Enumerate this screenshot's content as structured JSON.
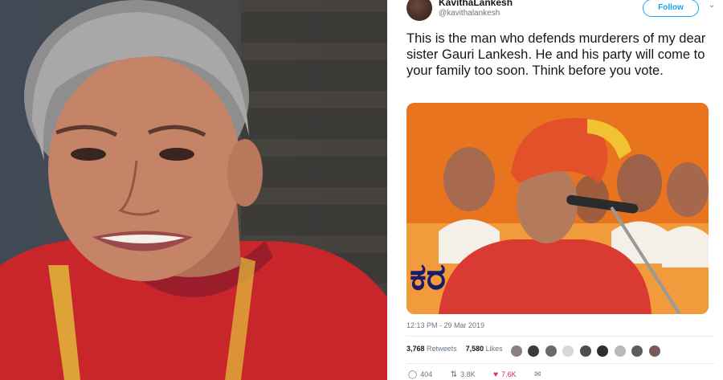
{
  "tweet": {
    "display_name": "KavithaLankesh",
    "handle": "@kavithalankesh",
    "follow_label": "Follow",
    "text": "This is the man who defends murderers of my dear sister  Gauri Lankesh. He and his party will come to your family too soon. Think before you vote.",
    "timestamp": "12:13 PM - 29 Mar 2019",
    "retweets_count": "3,768",
    "retweets_label": "Retweets",
    "likes_count": "7,580",
    "likes_label": "Likes",
    "actions": {
      "reply_count": "404",
      "retweet_count": "3.8K",
      "like_count": "7.6K"
    },
    "media_banner_text": "ಕರ"
  },
  "colors": {
    "twitter_blue": "#1da1f2",
    "like_red": "#e0245e",
    "banner_orange": "#e8741f",
    "kurta_red": "#d93a32"
  }
}
